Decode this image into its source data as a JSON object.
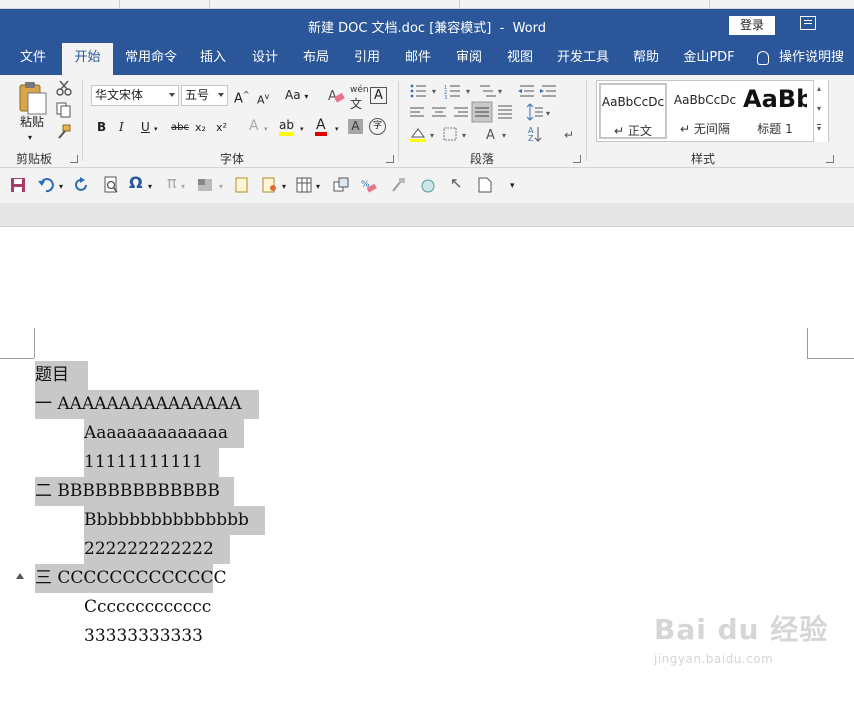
{
  "title_bar": {
    "doc_name": "新建 DOC 文档.doc",
    "mode": "[兼容模式]",
    "separator": "-",
    "app": "Word",
    "login_label": "登录"
  },
  "tabs": {
    "file": "文件",
    "home": "开始",
    "common": "常用命令",
    "insert": "插入",
    "design": "设计",
    "layout": "布局",
    "references": "引用",
    "mailings": "邮件",
    "review": "审阅",
    "view": "视图",
    "developer": "开发工具",
    "help": "帮助",
    "pdf": "金山PDF",
    "tell_me": "操作说明搜索"
  },
  "ribbon": {
    "clipboard": {
      "paste_label": "粘贴",
      "group_label": "剪贴板"
    },
    "font": {
      "font_name": "华文宋体",
      "font_size": "五号",
      "change_case": "Aa",
      "wen": "wén",
      "wen_char": "文",
      "char_border": "A",
      "bold": "B",
      "italic": "I",
      "underline": "U",
      "strike": "abc",
      "subscript": "x₂",
      "superscript": "x²",
      "text_effect": "A",
      "highlight": "ab",
      "font_color": "A",
      "shading": "A",
      "enclose": "字",
      "grow": "A",
      "shrink": "A",
      "group_label": "字体"
    },
    "paragraph": {
      "group_label": "段落"
    },
    "styles": {
      "group_label": "样式",
      "items": [
        {
          "sample": "AaBbCcDc",
          "name": "正文"
        },
        {
          "sample": "AaBbCcDc",
          "name": "无间隔"
        },
        {
          "sample": "AaBb",
          "name": "标题 1"
        }
      ]
    }
  },
  "document": {
    "paragraphs": [
      {
        "text": "题目"
      },
      {
        "text": "一  AAAAAAAAAAAAAAA"
      },
      {
        "text": "Aaaaaaaaaaaaaa"
      },
      {
        "text": "11111111111"
      },
      {
        "text": "二 BBBBBBBBBBBBB"
      },
      {
        "text": "Bbbbbbbbbbbbbbb"
      },
      {
        "text": "222222222222"
      },
      {
        "text": "三  CCCCCCCCCCCCC"
      },
      {
        "text": "Ccccccccccccc"
      },
      {
        "text": "33333333333"
      }
    ]
  },
  "watermark": {
    "main": "Bai du 经验",
    "sub": "jingyan.baidu.com"
  },
  "colors": {
    "title_bar": "#2b579a",
    "ribbon": "#f3f3f3",
    "selection": "#c8c8c8"
  }
}
